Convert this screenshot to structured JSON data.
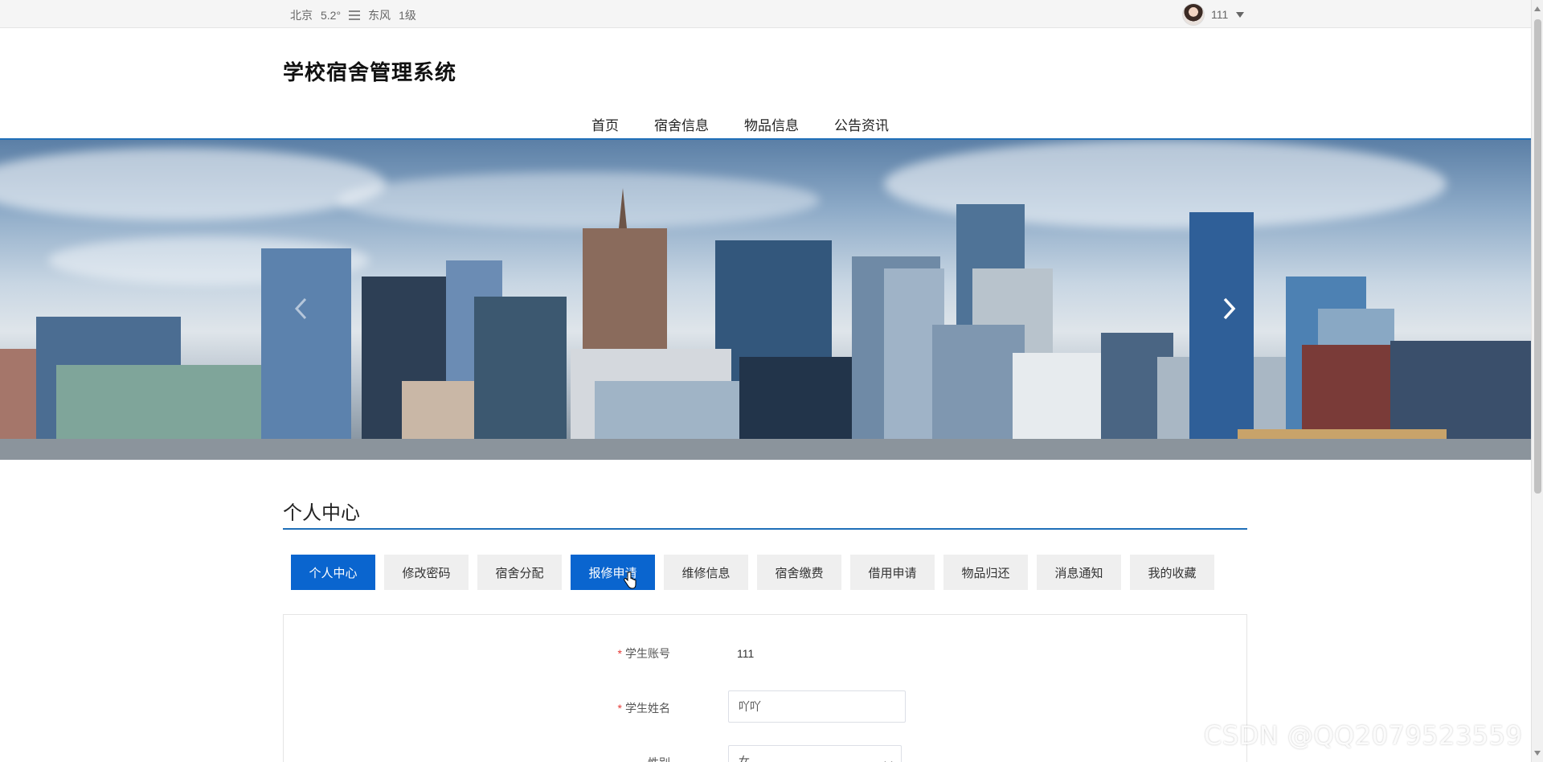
{
  "topbar": {
    "city": "北京",
    "temperature": "5.2°",
    "weather_icon": "haze-icon",
    "wind": "东风",
    "wind_level": "1级",
    "username": "111"
  },
  "header": {
    "site_title": "学校宿舍管理系统",
    "nav": [
      "首页",
      "宿舍信息",
      "物品信息",
      "公告资讯"
    ]
  },
  "section": {
    "title": "个人中心"
  },
  "tabs": [
    {
      "label": "个人中心",
      "active": true
    },
    {
      "label": "修改密码",
      "active": false
    },
    {
      "label": "宿舍分配",
      "active": false
    },
    {
      "label": "报修申请",
      "active": true
    },
    {
      "label": "维修信息",
      "active": false
    },
    {
      "label": "宿舍缴费",
      "active": false
    },
    {
      "label": "借用申请",
      "active": false
    },
    {
      "label": "物品归还",
      "active": false
    },
    {
      "label": "消息通知",
      "active": false
    },
    {
      "label": "我的收藏",
      "active": false
    }
  ],
  "form": {
    "account_label": "学生账号",
    "account_value": "111",
    "name_label": "学生姓名",
    "name_value": "吖吖",
    "gender_label": "性别",
    "gender_value": "女"
  },
  "watermark": "CSDN @QQ2079523559",
  "colors": {
    "accent": "#1f6fb8",
    "active_tab": "#0a65cf",
    "required": "#e53935"
  }
}
